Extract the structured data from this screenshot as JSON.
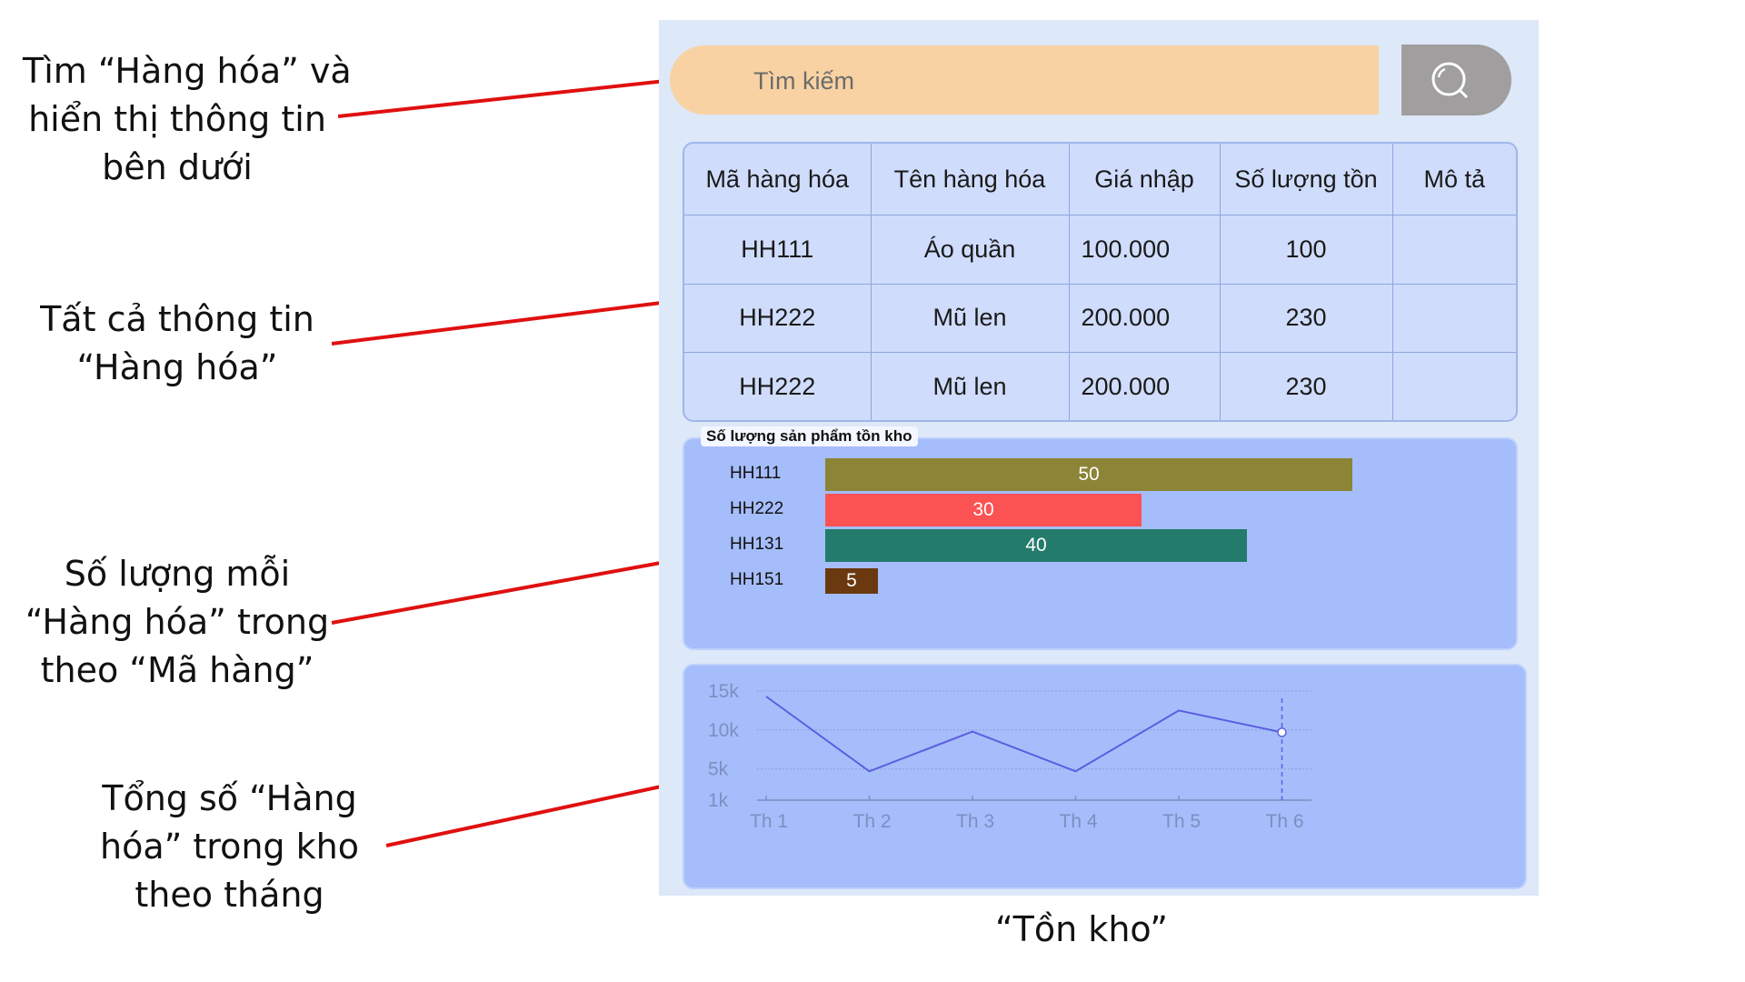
{
  "annotations": {
    "search_note": [
      "Tìm “Hàng hóa” và",
      "hiển thị thông tin",
      "bên dưới"
    ],
    "table_note": [
      "Tất cả thông tin",
      "“Hàng hóa”"
    ],
    "bar_note": [
      "Số lượng mỗi",
      "“Hàng hóa” trong",
      "theo “Mã hàng”"
    ],
    "line_note": [
      "Tổng số “Hàng",
      "hóa” trong kho",
      "theo tháng"
    ],
    "caption": "“Tồn kho”",
    "arrow_color": "#e01010"
  },
  "search": {
    "placeholder": "Tìm kiếm",
    "button_icon": "search-icon",
    "bar_color": "#f8d2a3",
    "button_color": "#a09e9e"
  },
  "table": {
    "headers": [
      "Mã hàng hóa",
      "Tên hàng hóa",
      "Giá nhập",
      "Số lượng tồn",
      "Mô tả"
    ],
    "rows": [
      [
        "HH111",
        "Áo quần",
        "100.000",
        "100",
        ""
      ],
      [
        "HH222",
        "Mũ len",
        "200.000",
        "230",
        ""
      ],
      [
        "HH222",
        "Mũ len",
        "200.000",
        "230",
        ""
      ]
    ]
  },
  "chart_data": [
    {
      "type": "bar",
      "title": "Số lượng sản phẩm tồn kho",
      "orientation": "horizontal",
      "categories": [
        "HH111",
        "HH222",
        "HH131",
        "HH151"
      ],
      "values": [
        50,
        30,
        40,
        5
      ],
      "colors": [
        "#8c8436",
        "#fb5253",
        "#237b6b",
        "#6b3910"
      ],
      "xlim": [
        0,
        50
      ]
    },
    {
      "type": "line",
      "x": [
        "Th 1",
        "Th 2",
        "Th 3",
        "Th 4",
        "Th 5",
        "Th 6"
      ],
      "values": [
        14300,
        4700,
        9800,
        4700,
        12500,
        9700
      ],
      "yticks": [
        "15k",
        "10k",
        "5k",
        "1k"
      ],
      "ylim": [
        1000,
        15000
      ],
      "line_color": "#5a5ee0",
      "grid": true,
      "highlight_index": 5
    }
  ]
}
